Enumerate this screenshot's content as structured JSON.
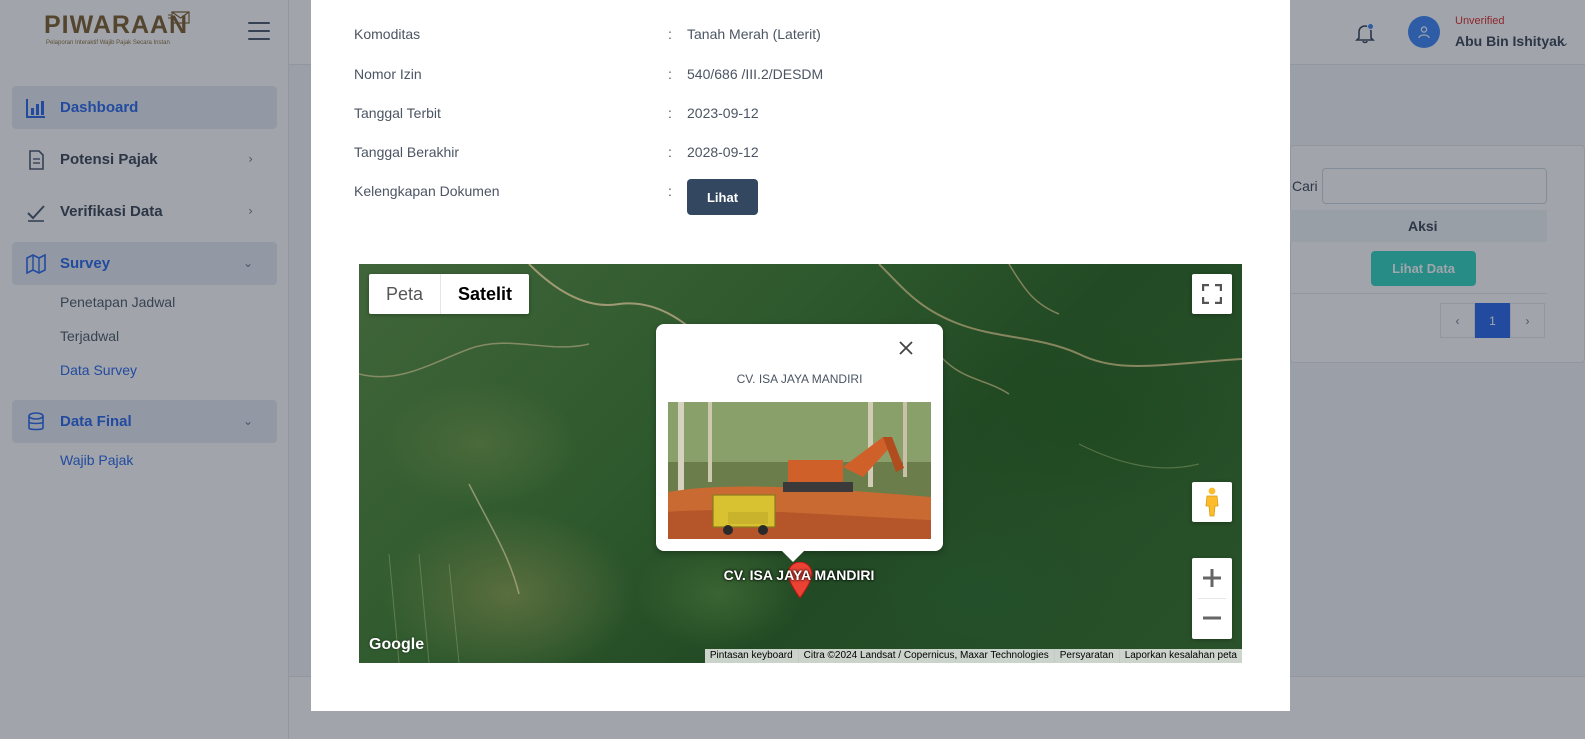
{
  "app": {
    "logo_text": "PIWARAAN",
    "logo_tagline": "Pelaporan Interaktif Wajib Pajak Secara Instan"
  },
  "sidebar": {
    "items": [
      {
        "label": "Dashboard",
        "icon": "chart-bar-icon"
      },
      {
        "label": "Potensi Pajak",
        "icon": "document-icon"
      },
      {
        "label": "Verifikasi Data",
        "icon": "check-icon"
      },
      {
        "label": "Survey",
        "icon": "map-icon",
        "subitems": [
          "Penetapan Jadwal",
          "Terjadwal",
          "Data Survey"
        ]
      },
      {
        "label": "Data Final",
        "icon": "database-icon",
        "subitems": [
          "Wajib Pajak"
        ]
      }
    ]
  },
  "header": {
    "user_status": "Unverified",
    "user_name": "Abu Bin Ishityak",
    "colors": {
      "status": "#dc2626",
      "avatar": "#3b82f6"
    }
  },
  "background_table": {
    "search_label": "Cari",
    "column_aksi": "Aksi",
    "row_button": "Lihat Data",
    "pagination": {
      "prev": "‹",
      "current": "1",
      "next": "›"
    }
  },
  "modal": {
    "rows": [
      {
        "label": "Komoditas",
        "colon": ":",
        "value": "Tanah Merah (Laterit)"
      },
      {
        "label": "Nomor Izin",
        "colon": ":",
        "value": "540/686 /III.2/DESDM"
      },
      {
        "label": "Tanggal Terbit",
        "colon": ":",
        "value": "2023-09-12"
      },
      {
        "label": "Tanggal Berakhir",
        "colon": ":",
        "value": "2028-09-12"
      },
      {
        "label": "Kelengkapan Dokumen",
        "colon": ":",
        "button": "Lihat"
      }
    ]
  },
  "map": {
    "type_options": [
      "Peta",
      "Satelit"
    ],
    "selected_type": "Satelit",
    "info_window_title": "CV. ISA JAYA MANDIRI",
    "marker_label": "CV. ISA JAYA MANDIRI",
    "google_logo": "Google",
    "attribution": [
      "Pintasan keyboard",
      "Citra ©2024 Landsat / Copernicus, Maxar Technologies",
      "Persyaratan",
      "Laporkan kesalahan peta"
    ]
  }
}
